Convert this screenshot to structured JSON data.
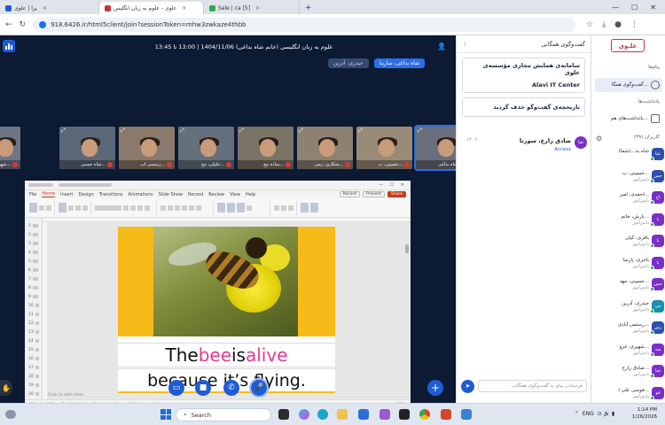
{
  "browser": {
    "tabs": [
      {
        "label": "يرا | علوی",
        "active": false,
        "color": "#1e5bd6"
      },
      {
        "label": "علوی - علوم به زبان انگلیس",
        "active": true,
        "color": "#c9333a"
      },
      {
        "label": "Sale | ca [5]",
        "active": false,
        "color": "#2ea84f"
      }
    ],
    "new_tab": "+",
    "url": "918.6426.ir/html5client/join?sessionToken=mhw3zwkaze4thbb"
  },
  "meeting": {
    "title": "علوم به زبان انگلیسی (خانم شاه بداغی) 1404/11/06 | 13:00 تا 13:45",
    "presenter_chip": "شاه بداغی، سارینا",
    "guest_chip": "حیدری، آدرین"
  },
  "thumbnails": [
    {
      "name": "شهیری کو...",
      "bg": "#6e7585",
      "speaking": false
    },
    {
      "name": "شاه حسنی...",
      "bg": "#5c6878",
      "speaking": false
    },
    {
      "name": "رستمی آب...",
      "bg": "#8a7a6b",
      "speaking": false
    },
    {
      "name": "جلیلی، مح...",
      "bg": "#65707d",
      "speaking": false
    },
    {
      "name": "ساده مج...",
      "bg": "#7b7466",
      "speaking": false
    },
    {
      "name": "شکاری، زمی...",
      "bg": "#8c8173",
      "speaking": false
    },
    {
      "name": "حسینی، ب...",
      "bg": "#9a8a78",
      "speaking": false
    },
    {
      "name": "شاه بداغی...",
      "bg": "#6b6e7c",
      "speaking": true
    }
  ],
  "ppt": {
    "menu": [
      "File",
      "Home",
      "Insert",
      "Design",
      "Transitions",
      "Animations",
      "Slide Show",
      "Record",
      "Review",
      "View",
      "Help"
    ],
    "active_menu": "Home",
    "record_label": "Record",
    "present_label": "Present",
    "share_label": "Share",
    "notes_placeholder": "Click to add notes",
    "slide_numbers": [
      "1",
      "2",
      "3",
      "4",
      "5",
      "6",
      "7",
      "8",
      "9",
      "10",
      "11",
      "12",
      "13",
      "14",
      "15",
      "16",
      "17",
      "18",
      "19",
      "20"
    ],
    "status_left": "Slide 4 of 20",
    "status_mid": "English (United States)",
    "status_access": "Accessibility: Investigate",
    "zoom": "80%",
    "slide": {
      "line1": [
        "The ",
        "bee",
        " is ",
        "alive"
      ],
      "line2": "because it’s flying."
    }
  },
  "controls": {
    "hand_icon": "hand-icon",
    "screen": "screen-icon",
    "camera": "camera-icon",
    "phone": "phone-icon",
    "mic": "mic-icon",
    "plus": "+"
  },
  "chat": {
    "header": "گفت‌وگوی همگانی",
    "notice_title": "سامانه‌ی همایش مجازی مؤسسه‌ی علوی",
    "notice_org": "Alavi IT Center",
    "history_notice": "تاریخچه‌ی گفت‌وگو حذف گردید",
    "message": {
      "avatar": "صا",
      "name": "صادق زارع، سورنا",
      "time": "۱۳:۰۶",
      "text": "Access"
    },
    "input_placeholder": "فرستادن پیام به گفت‌وگوی همگانی",
    "send_icon": "send-icon"
  },
  "sidebar": {
    "logo": "علـوی",
    "messages_heading": "پیام‌ها",
    "public_chat": "گفت‌وگوی همگا...",
    "notes_heading": "یادداشت‌ها",
    "shared_notes": "یادداشت‌های هم...",
    "users_heading": "کاربران (۲۹)",
    "users": [
      {
        "initials": "شا",
        "name": "شاه بد...(شما)",
        "sub": "",
        "style": "blue"
      },
      {
        "initials": "حس",
        "name": "حسینی، ب...",
        "sub": "دانش‌آموز",
        "style": "blue"
      },
      {
        "initials": "اح",
        "name": "احمدی، امیر...",
        "sub": "دانش‌آموز",
        "style": "purple"
      },
      {
        "initials": "با",
        "name": "بارش، خانم...",
        "sub": "دانش‌آموز",
        "style": "purple"
      },
      {
        "initials": "با",
        "name": "باقری، کیان",
        "sub": "دانش‌آموز",
        "style": "purple"
      },
      {
        "initials": "با",
        "name": "باجری، پارسا",
        "sub": "دانش‌آموز",
        "style": "purple"
      },
      {
        "initials": "حس",
        "name": "حسینی، مهد...",
        "sub": "دانش‌آموز",
        "style": "purple"
      },
      {
        "initials": "حی",
        "name": "حیدری، آدرین",
        "sub": "دانش‌آموز",
        "style": "teal"
      },
      {
        "initials": "رس",
        "name": "رستمی آبادی...",
        "sub": "دانش‌آموز",
        "style": "blue"
      },
      {
        "initials": "شه",
        "name": "شهیری، غزو...",
        "sub": "دانش‌آموز",
        "style": "purple"
      },
      {
        "initials": "صا",
        "name": "صادق زارع...",
        "sub": "دانش‌آموز",
        "style": "purple"
      },
      {
        "initials": "فو",
        "name": "فوسی علی ا...",
        "sub": "دانش‌آموز",
        "style": "purple"
      }
    ]
  },
  "taskbar": {
    "search_placeholder": "Search",
    "lang": "ENG",
    "time": "1:14 PM",
    "date": "1/26/2026"
  },
  "colors": {
    "accent": "#1e5bd6",
    "video_bg": "#0c1a33",
    "slide_yellow": "#f6bb18",
    "highlight_pink": "#e8398e",
    "brand_red": "#c9333a"
  }
}
